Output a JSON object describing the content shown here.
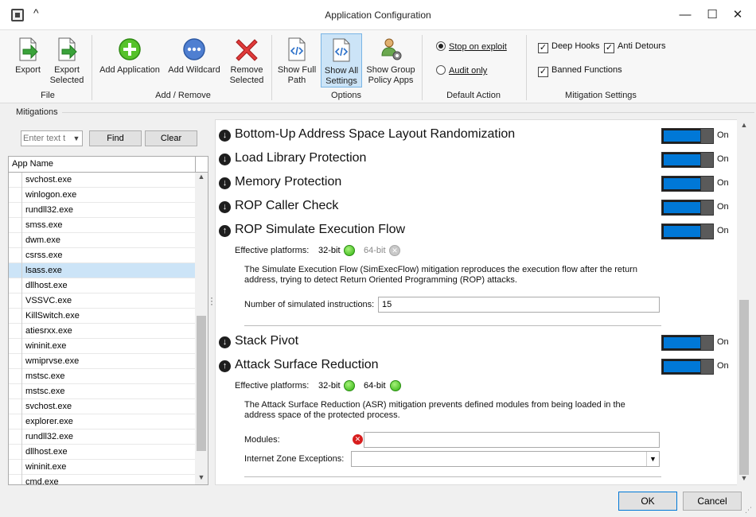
{
  "window": {
    "title": "Application Configuration",
    "minimize": "—",
    "maximize": "☐",
    "close": "✕",
    "collapse": "^"
  },
  "ribbon": {
    "groups": [
      {
        "label": "File"
      },
      {
        "label": "Add / Remove"
      },
      {
        "label": "Options"
      },
      {
        "label": "Default Action"
      },
      {
        "label": "Mitigation Settings"
      }
    ],
    "buttons": {
      "export": "Export",
      "export_selected": "Export\nSelected",
      "add_application": "Add Application",
      "add_wildcard": "Add Wildcard",
      "remove_selected": "Remove\nSelected",
      "show_full_path": "Show Full\nPath",
      "show_all_settings": "Show All\nSettings",
      "show_group_policy": "Show Group\nPolicy Apps"
    },
    "default_action": {
      "stop_on_exploit": "Stop on exploit",
      "audit_only": "Audit only"
    },
    "settings": {
      "deep_hooks": "Deep Hooks",
      "anti_detours": "Anti Detours",
      "banned_functions": "Banned Functions"
    }
  },
  "mitigations_label": "Mitigations",
  "left": {
    "search_placeholder": "Enter text t",
    "find": "Find",
    "clear": "Clear",
    "column": "App Name",
    "apps": [
      "svchost.exe",
      "winlogon.exe",
      "rundll32.exe",
      "smss.exe",
      "dwm.exe",
      "csrss.exe",
      "lsass.exe",
      "dllhost.exe",
      "VSSVC.exe",
      "KillSwitch.exe",
      "atiesrxx.exe",
      "wininit.exe",
      "wmiprvse.exe",
      "mstsc.exe",
      "mstsc.exe",
      "svchost.exe",
      "explorer.exe",
      "rundll32.exe",
      "dllhost.exe",
      "wininit.exe",
      "cmd.exe"
    ],
    "selected_index": 6
  },
  "right": {
    "mitigations": {
      "aslr": "Bottom-Up Address Space Layout Randomization",
      "load_lib": "Load Library Protection",
      "memory": "Memory Protection",
      "rop_caller": "ROP Caller Check",
      "rop_sim": "ROP Simulate Execution Flow",
      "stack_pivot": "Stack Pivot",
      "asr": "Attack Surface Reduction"
    },
    "on_label": "On",
    "effective_platforms": "Effective platforms:",
    "p32": "32-bit",
    "p64": "64-bit",
    "sim_desc": "The Simulate Execution Flow (SimExecFlow) mitigation reproduces the execution flow after the return address, trying to detect Return Oriented Programming (ROP) attacks.",
    "sim_field_label": "Number of simulated instructions:",
    "sim_field_value": "15",
    "asr_desc": "The Attack Surface Reduction (ASR) mitigation prevents defined modules from being loaded in the address space of the protected process.",
    "modules_label": "Modules:",
    "zone_label": "Internet Zone Exceptions:"
  },
  "footer": {
    "ok": "OK",
    "cancel": "Cancel"
  },
  "colors": {
    "accent": "#0078d7",
    "selection": "#cce4f7"
  }
}
